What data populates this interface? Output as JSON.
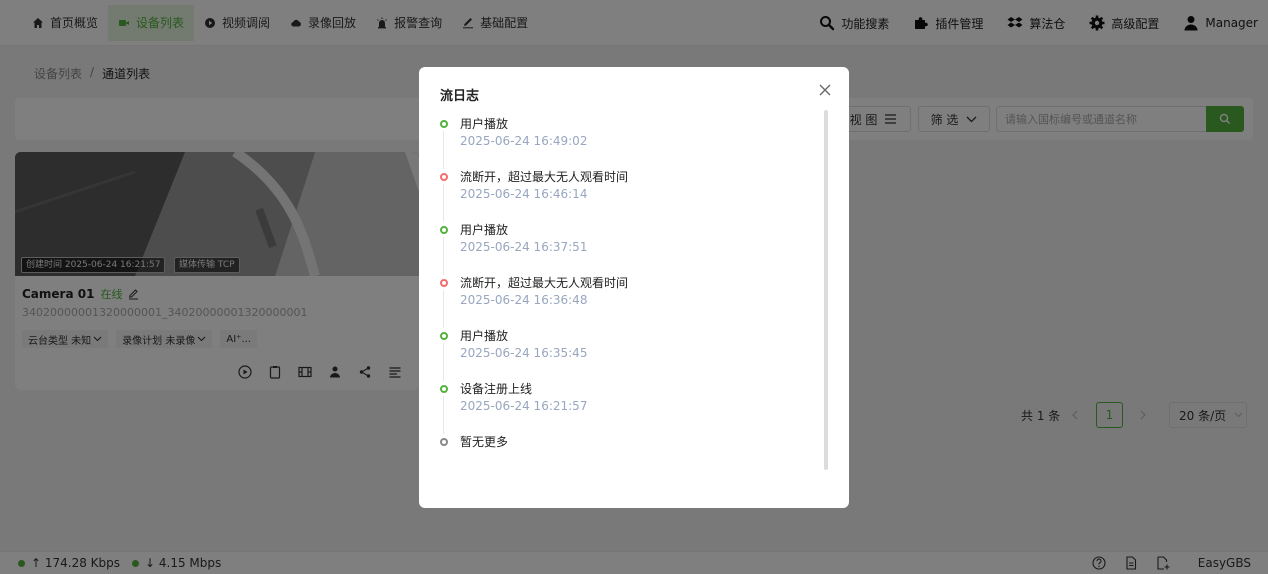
{
  "nav": {
    "items": [
      {
        "label": "首页概览",
        "icon": "home-icon",
        "active": false
      },
      {
        "label": "设备列表",
        "icon": "video-camera-icon",
        "active": true
      },
      {
        "label": "视频调阅",
        "icon": "play-circle-icon",
        "active": false
      },
      {
        "label": "录像回放",
        "icon": "cloud-icon",
        "active": false
      },
      {
        "label": "报警查询",
        "icon": "alarm-icon",
        "active": false
      },
      {
        "label": "基础配置",
        "icon": "pen-icon",
        "active": false
      }
    ],
    "right": [
      {
        "label": "功能搜素",
        "icon": "search-icon"
      },
      {
        "label": "插件管理",
        "icon": "puzzle-icon"
      },
      {
        "label": "算法仓",
        "icon": "box-icon"
      },
      {
        "label": "高级配置",
        "icon": "gear-icon"
      },
      {
        "label": "Manager",
        "icon": "user-icon"
      }
    ]
  },
  "breadcrumb": {
    "parent": "设备列表",
    "separator": "/",
    "current": "通道列表"
  },
  "toolbar": {
    "view_label": "视 图",
    "filter_label": "筛 选",
    "search_placeholder": "请输入国标编号或通道名称"
  },
  "card": {
    "created_tag": "创建时间 2025-06-24 16:21:57",
    "transport_tag": "媒体传输 TCP",
    "name": "Camera 01",
    "status": "在线",
    "id": "34020000001320000001_34020000001320000001",
    "chips": [
      "云台类型 未知",
      "录像计划 未录像",
      "AI⁺..."
    ]
  },
  "pager": {
    "total": "共 1 条",
    "page": "1",
    "page_size": "20 条/页"
  },
  "footer": {
    "upload": "↑ 174.28 Kbps",
    "download": "↓ 4.15 Mbps",
    "brand": "EasyGBS"
  },
  "modal": {
    "title": "流日志",
    "entries": [
      {
        "text": "用户播放",
        "time": "2025-06-24 16:49:02",
        "status": "green"
      },
      {
        "text": "流断开，超过最大无人观看时间",
        "time": "2025-06-24 16:46:14",
        "status": "red"
      },
      {
        "text": "用户播放",
        "time": "2025-06-24 16:37:51",
        "status": "green"
      },
      {
        "text": "流断开，超过最大无人观看时间",
        "time": "2025-06-24 16:36:48",
        "status": "red"
      },
      {
        "text": "用户播放",
        "time": "2025-06-24 16:35:45",
        "status": "green"
      },
      {
        "text": "设备注册上线",
        "time": "2025-06-24 16:21:57",
        "status": "green"
      },
      {
        "text": "暂无更多",
        "time": "",
        "status": "gray"
      }
    ]
  },
  "colors": {
    "accent": "#52b33c",
    "error": "#f56c6c",
    "muted_time": "#98a6bf"
  }
}
